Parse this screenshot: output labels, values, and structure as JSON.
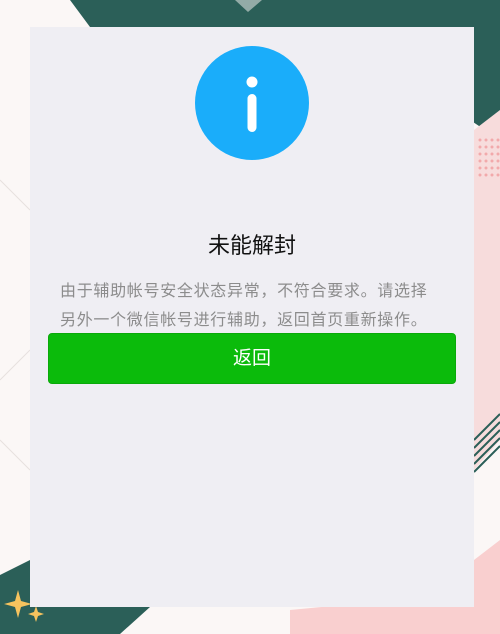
{
  "dialog": {
    "icon": "info-icon",
    "title": "未能解封",
    "message_lines": [
      "由于辅助帐号安全状态异常，不符合要求。请选择",
      "另外一个微信帐号进行辅助，返回首页重新操作。"
    ],
    "back_button_label": "返回"
  },
  "colors": {
    "icon_blue": "#1aadfa",
    "button_green": "#0bbb0b",
    "card_background": "#efeef3",
    "background_teal": "#2b5f58",
    "background_pink": "#f9cfcf"
  }
}
